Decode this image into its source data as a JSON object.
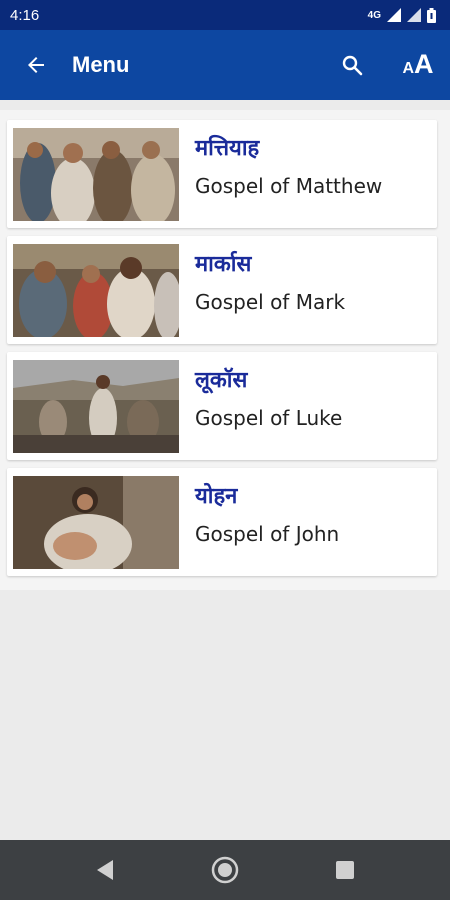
{
  "status_bar": {
    "time": "4:16",
    "network": "4G"
  },
  "app_bar": {
    "title": "Menu"
  },
  "gospels": [
    {
      "title_hi": "मत्तियाह",
      "subtitle": "Gospel of Matthew",
      "image": "matthew-painting"
    },
    {
      "title_hi": "मार्कास",
      "subtitle": "Gospel of Mark",
      "image": "mark-painting"
    },
    {
      "title_hi": "लूकॉस",
      "subtitle": "Gospel of Luke",
      "image": "luke-painting"
    },
    {
      "title_hi": "योहन",
      "subtitle": "Gospel of John",
      "image": "john-painting"
    }
  ],
  "colors": {
    "status_bar": "#0a2a7a",
    "app_bar": "#0d47a1",
    "title_text": "#1a2b9a",
    "nav_bar": "#3d4043"
  }
}
